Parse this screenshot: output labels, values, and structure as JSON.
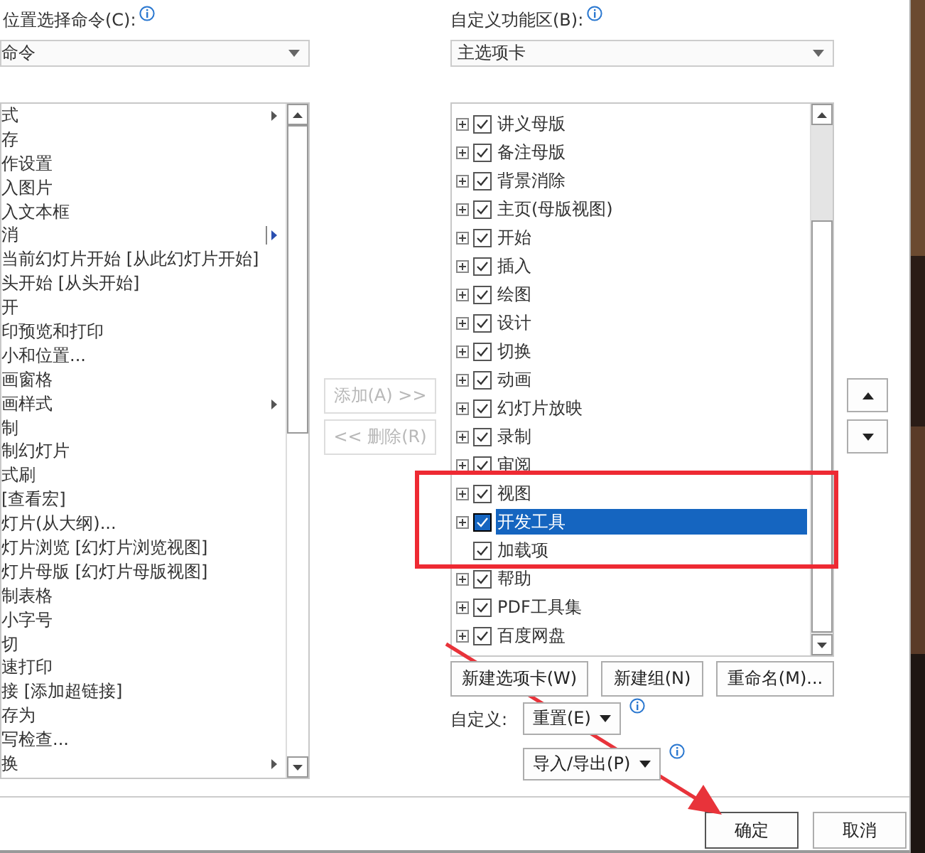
{
  "left_panel": {
    "label": "位置选择命令(C):",
    "dropdown": {
      "value": "命令"
    },
    "commands": [
      {
        "text": "式",
        "kind": "submenu"
      },
      {
        "text": "存",
        "kind": "plain"
      },
      {
        "text": "作设置",
        "kind": "plain"
      },
      {
        "text": "入图片",
        "kind": "plain"
      },
      {
        "text": "入文本框",
        "kind": "plain"
      },
      {
        "text": "消",
        "kind": "split"
      },
      {
        "text": "当前幻灯片开始 [从此幻灯片开始]",
        "kind": "plain"
      },
      {
        "text": "头开始 [从头开始]",
        "kind": "plain"
      },
      {
        "text": "开",
        "kind": "plain"
      },
      {
        "text": "印预览和打印",
        "kind": "plain"
      },
      {
        "text": "小和位置...",
        "kind": "plain"
      },
      {
        "text": "画窗格",
        "kind": "plain"
      },
      {
        "text": "画样式",
        "kind": "submenu"
      },
      {
        "text": "制",
        "kind": "plain"
      },
      {
        "text": "制幻灯片",
        "kind": "plain"
      },
      {
        "text": "式刷",
        "kind": "plain"
      },
      {
        "text": "[查看宏]",
        "kind": "plain"
      },
      {
        "text": "灯片(从大纲)...",
        "kind": "plain"
      },
      {
        "text": "灯片浏览 [幻灯片浏览视图]",
        "kind": "plain"
      },
      {
        "text": "灯片母版 [幻灯片母版视图]",
        "kind": "plain"
      },
      {
        "text": "制表格",
        "kind": "plain"
      },
      {
        "text": "小字号",
        "kind": "plain"
      },
      {
        "text": "切",
        "kind": "plain"
      },
      {
        "text": "速打印",
        "kind": "plain"
      },
      {
        "text": "接 [添加超链接]",
        "kind": "plain"
      },
      {
        "text": "存为",
        "kind": "plain"
      },
      {
        "text": "写检查...",
        "kind": "plain"
      },
      {
        "text": "换",
        "kind": "submenu"
      }
    ]
  },
  "middle_buttons": [
    {
      "label": "添加(A) >>",
      "disabled": true
    },
    {
      "label": "<< 删除(R)",
      "disabled": true
    }
  ],
  "right_panel": {
    "label": "自定义功能区(B):",
    "dropdown": {
      "value": "主选项卡"
    },
    "tabs": [
      {
        "label": "讲义母版",
        "checked": true,
        "expandable": true,
        "selected": false
      },
      {
        "label": "备注母版",
        "checked": true,
        "expandable": true,
        "selected": false
      },
      {
        "label": "背景消除",
        "checked": true,
        "expandable": true,
        "selected": false
      },
      {
        "label": "主页(母版视图)",
        "checked": true,
        "expandable": true,
        "selected": false
      },
      {
        "label": "开始",
        "checked": true,
        "expandable": true,
        "selected": false
      },
      {
        "label": "插入",
        "checked": true,
        "expandable": true,
        "selected": false
      },
      {
        "label": "绘图",
        "checked": true,
        "expandable": true,
        "selected": false
      },
      {
        "label": "设计",
        "checked": true,
        "expandable": true,
        "selected": false
      },
      {
        "label": "切换",
        "checked": true,
        "expandable": true,
        "selected": false
      },
      {
        "label": "动画",
        "checked": true,
        "expandable": true,
        "selected": false
      },
      {
        "label": "幻灯片放映",
        "checked": true,
        "expandable": true,
        "selected": false
      },
      {
        "label": "录制",
        "checked": true,
        "expandable": true,
        "selected": false
      },
      {
        "label": "审阅",
        "checked": true,
        "expandable": true,
        "selected": false
      },
      {
        "label": "视图",
        "checked": true,
        "expandable": true,
        "selected": false
      },
      {
        "label": "开发工具",
        "checked": true,
        "expandable": true,
        "selected": true
      },
      {
        "label": "加载项",
        "checked": true,
        "expandable": false,
        "selected": false
      },
      {
        "label": "帮助",
        "checked": true,
        "expandable": true,
        "selected": false
      },
      {
        "label": "PDF工具集",
        "checked": true,
        "expandable": true,
        "selected": false
      },
      {
        "label": "百度网盘",
        "checked": true,
        "expandable": true,
        "selected": false
      }
    ],
    "buttons": [
      "新建选项卡(W)",
      "新建组(N)",
      "重命名(M)..."
    ],
    "customize_label": "自定义:",
    "reset_button": "重置(E)",
    "import_export_button": "导入/导出(P)"
  },
  "footer_buttons": [
    "确定",
    "取消"
  ],
  "annotations": {
    "highlight_frame": true,
    "pointer_arrow": true
  }
}
